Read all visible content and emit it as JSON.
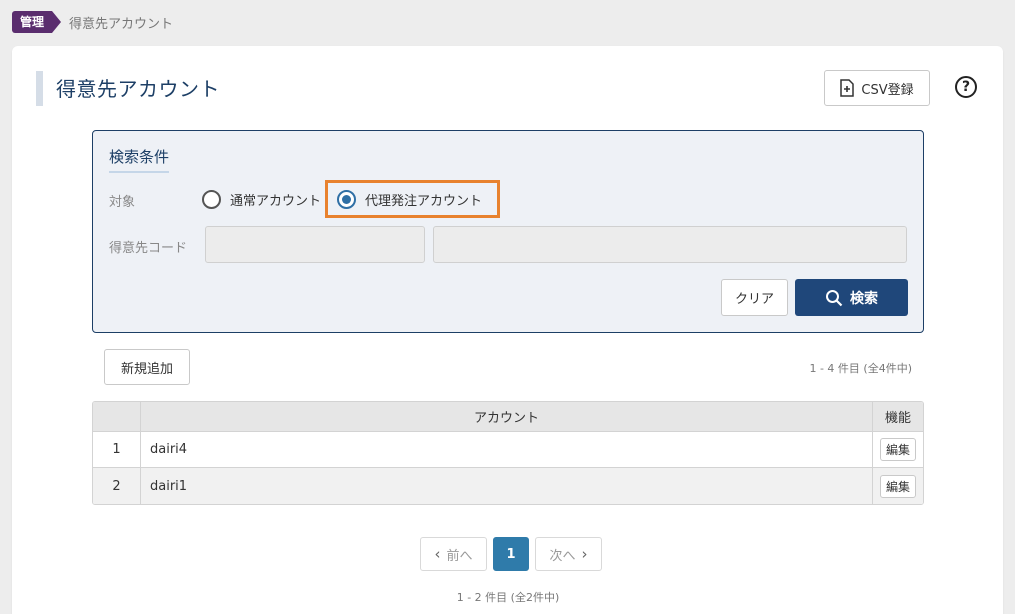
{
  "breadcrumb": {
    "tag": "管理",
    "current": "得意先アカウント"
  },
  "header": {
    "title": "得意先アカウント",
    "csv_button": "CSV登録",
    "help_glyph": "?"
  },
  "search": {
    "title": "検索条件",
    "target_label": "対象",
    "options": [
      {
        "label": "通常アカウント",
        "checked": false
      },
      {
        "label": "代理発注アカウント",
        "checked": true
      }
    ],
    "code_label": "得意先コード",
    "code_value": "",
    "name_value": "",
    "clear_button": "クリア",
    "search_button": "検索"
  },
  "toolbar": {
    "add_button": "新規追加",
    "count": "1 - 4 件目 (全4件中)"
  },
  "table": {
    "columns": [
      "",
      "アカウント",
      "機能"
    ],
    "rows": [
      {
        "no": "1",
        "account": "dairi4",
        "action": "編集"
      },
      {
        "no": "2",
        "account": "dairi1",
        "action": "編集"
      }
    ]
  },
  "pagination": {
    "prev": "前へ",
    "current": "1",
    "next": "次へ",
    "count": "1 - 2 件目 (全2件中)"
  },
  "colors": {
    "brand": "#5a2d6e",
    "primary": "#1f477a",
    "highlight": "#e8822e",
    "active_page": "#2f7baa"
  }
}
